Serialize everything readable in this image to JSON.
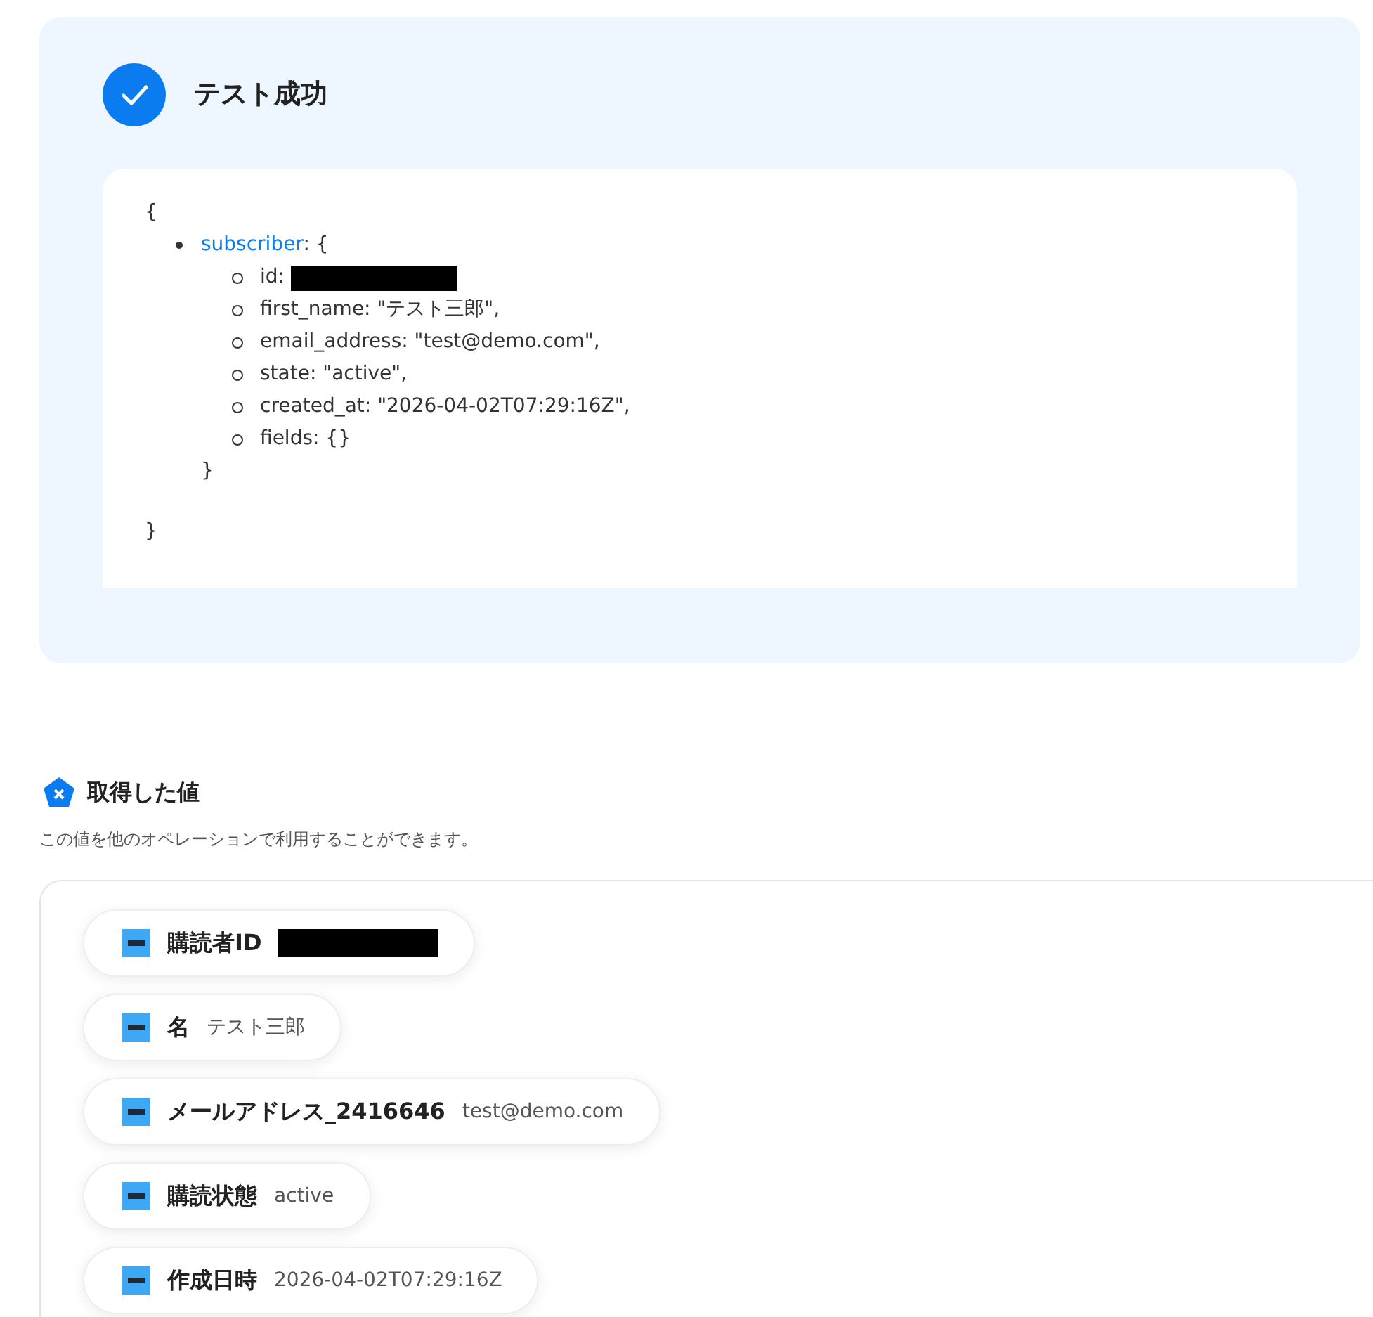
{
  "result": {
    "success": true,
    "title": "テスト成功",
    "code": {
      "open": "{",
      "close": "}",
      "key": "subscriber",
      "key_suffix": ": {",
      "inner_close": "}",
      "fields": [
        {
          "label": "id:",
          "redacted": true
        },
        {
          "label": "first_name: \"テスト三郎\","
        },
        {
          "label": "email_address: \"test@demo.com\","
        },
        {
          "label": "state: \"active\","
        },
        {
          "label": "created_at: \"2026-04-02T07:29:16Z\","
        },
        {
          "label": "fields: {}"
        }
      ]
    }
  },
  "values": {
    "title": "取得した値",
    "description": "この値を他のオペレーションで利用することができます。",
    "items": [
      {
        "name": "購読者ID",
        "redacted": true
      },
      {
        "name": "名",
        "value": "テスト三郎"
      },
      {
        "name": "メールアドレス_2416646",
        "value": "test@demo.com"
      },
      {
        "name": "購読状態",
        "value": "active"
      },
      {
        "name": "作成日時",
        "value": "2026-04-02T07:29:16Z"
      }
    ]
  }
}
